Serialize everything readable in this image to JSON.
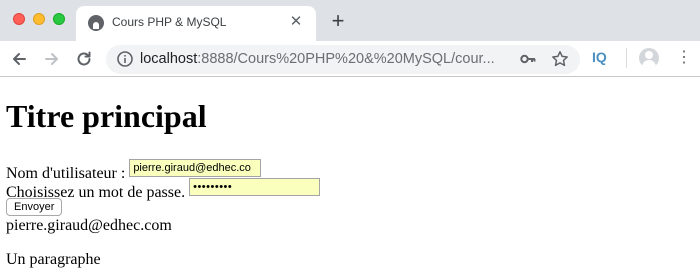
{
  "browser": {
    "tab_title": "Cours PHP & MySQL",
    "new_tab_symbol": "+",
    "tab_close_symbol": "✕",
    "url_host": "localhost",
    "url_rest": ":8888/Cours%20PHP%20&%20MySQL/cour...",
    "extension_label": "IQ",
    "menu_symbol": "⋮",
    "icons": [
      "back-arrow-icon",
      "forward-arrow-icon",
      "reload-icon",
      "info-icon",
      "key-icon",
      "star-icon",
      "profile-icon",
      "menu-icon"
    ],
    "colors": {
      "close": "#fe5f57",
      "minimize": "#febc2e",
      "maximize": "#28c840",
      "autofill": "#faffbd"
    }
  },
  "page": {
    "heading": "Titre principal",
    "form": {
      "username_label": "Nom d'utilisateur :",
      "username_value": "pierre.giraud@edhec.co",
      "password_label": "Choisissez un mot de passe.",
      "password_value": "•••••••••",
      "submit_label": "Envoyer"
    },
    "email_output": "pierre.giraud@edhec.com",
    "paragraph": "Un paragraphe"
  }
}
